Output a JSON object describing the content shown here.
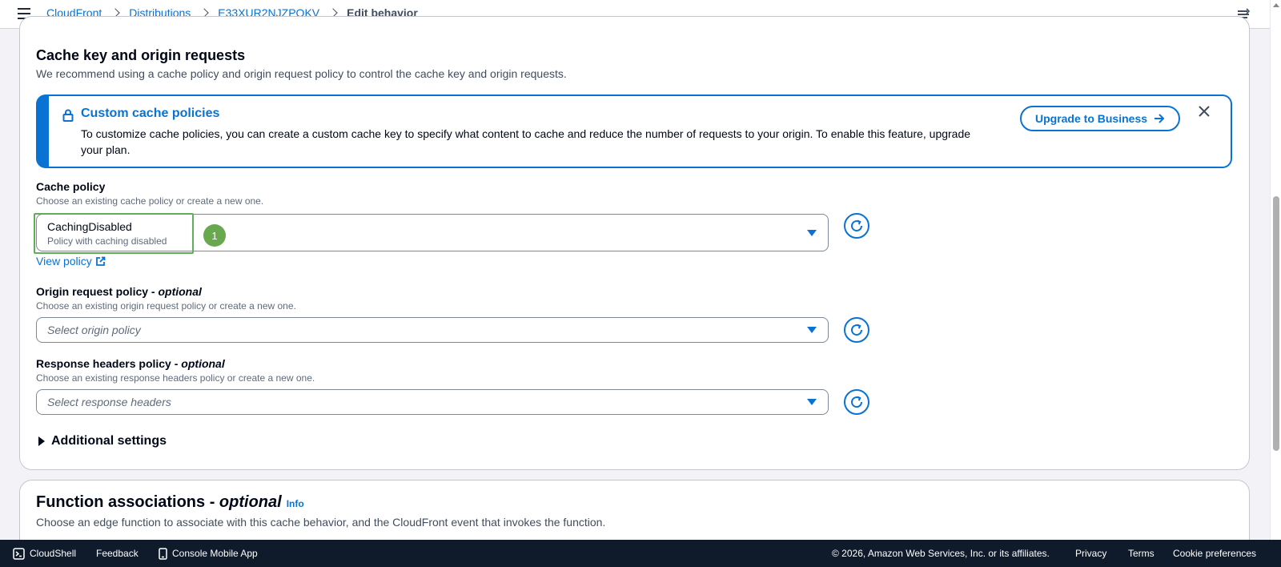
{
  "breadcrumb": {
    "items": [
      "CloudFront",
      "Distributions",
      "E33XUR2NJZPOKV"
    ],
    "current": "Edit behavior"
  },
  "section": {
    "title": "Cache key and origin requests",
    "description": "We recommend using a cache policy and origin request policy to control the cache key and origin requests."
  },
  "alert": {
    "title": "Custom cache policies",
    "text": "To customize cache policies, you can create a custom cache key to specify what content to cache and reduce the number of requests to your origin. To enable this feature, upgrade your plan.",
    "button_label": "Upgrade to Business"
  },
  "cache_policy": {
    "label": "Cache policy",
    "description": "Choose an existing cache policy or create a new one.",
    "selected_value": "CachingDisabled",
    "selected_description": "Policy with caching disabled",
    "view_link": "View policy",
    "annotation_number": "1"
  },
  "origin_request_policy": {
    "label": "Origin request policy - ",
    "label_optional": "optional",
    "description": "Choose an existing origin request policy or create a new one.",
    "placeholder": "Select origin policy"
  },
  "response_headers_policy": {
    "label": "Response headers policy - ",
    "label_optional": "optional",
    "description": "Choose an existing response headers policy or create a new one.",
    "placeholder": "Select response headers"
  },
  "additional_settings": {
    "label": "Additional settings"
  },
  "function_associations": {
    "title": "Function associations - ",
    "title_optional": "optional",
    "info": "Info",
    "description": "Choose an edge function to associate with this cache behavior, and the CloudFront event that invokes the function."
  },
  "footer": {
    "cloudshell": "CloudShell",
    "feedback": "Feedback",
    "mobile_app": "Console Mobile App",
    "copyright": "© 2026, Amazon Web Services, Inc. or its affiliates.",
    "privacy": "Privacy",
    "terms": "Terms",
    "cookie": "Cookie preferences"
  },
  "colors": {
    "link": "#0972d3",
    "footer_bg": "#0f1b2a",
    "highlight": "#5fae5a",
    "badge": "#6aa84f"
  }
}
